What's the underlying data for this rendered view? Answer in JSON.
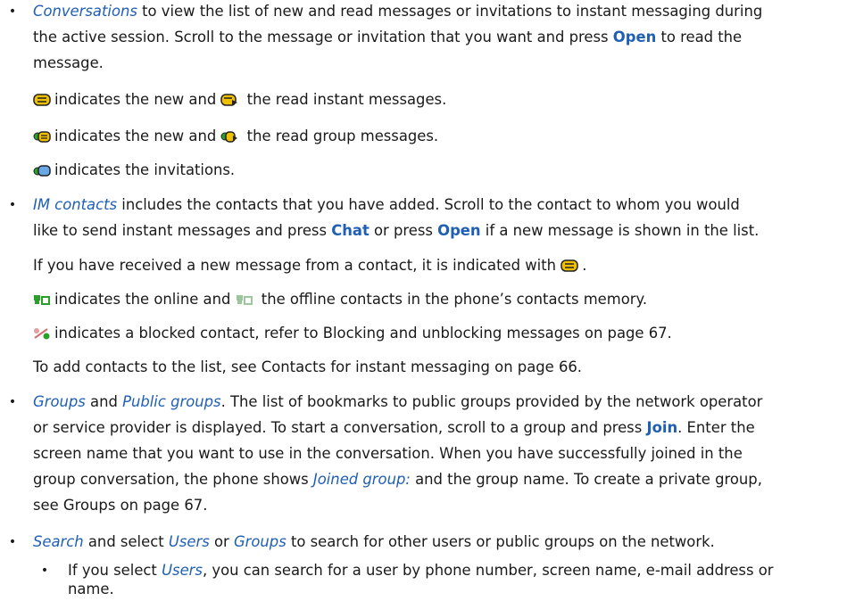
{
  "bullet_glyph": "•",
  "conversations": {
    "title": "Conversations",
    "l1": " to view the list of new and read messages or invitations to instant messaging during",
    "l2a": "the active session. Scroll to the message or invitation that you want and press ",
    "open": "Open",
    "l2b": " to read the",
    "l3": "message.",
    "im_line_a": "indicates the new and ",
    "im_line_b": " the read instant messages.",
    "grp_line_a": "indicates the new and ",
    "grp_line_b": " the read group messages.",
    "inv_line": "indicates the invitations."
  },
  "im_contacts": {
    "title": "IM contacts",
    "l1": " includes the contacts that you have added. Scroll to the contact to whom you would",
    "l2a": "like to send instant messages and press ",
    "chat": "Chat",
    "l2b": " or press ",
    "open": "Open",
    "l2c": " if a new message is shown in the list.",
    "received": "If you have received a new message from a contact, it is indicated with ",
    "received_end": ".",
    "online_a": "indicates the online and ",
    "online_b": " the offline contacts in the phone’s contacts memory.",
    "blocked": "indicates a blocked contact, refer to Blocking and unblocking messages on page 67.",
    "add": "To add contacts to the list, see Contacts for instant messaging on page 66."
  },
  "groups": {
    "title1": "Groups",
    "and": " and ",
    "title2": "Public groups",
    "l1": ". The list of bookmarks to public groups provided by the network operator",
    "l2a": "or service provider is displayed. To start a conversation, scroll to a group and press ",
    "join": "Join",
    "l2b": ". Enter the",
    "l3": "screen name that you want to use in the conversation. When you have successfully joined in the",
    "l4a": "group conversation, the phone shows ",
    "joined": "Joined group:",
    "l4b": " and the group name. To create a private group,",
    "l5": "see Groups on page 67."
  },
  "search": {
    "title": "Search",
    "l1a": " and select ",
    "users": "Users",
    "or": " or ",
    "groups": "Groups",
    "l1b": " to search for other users or public groups on the network.",
    "sub_a": "If you select ",
    "sub_users": "Users",
    "sub_b": ", you can search for a user by phone number, screen name, e-mail address or",
    "sub_c": "name."
  },
  "colors": {
    "accent": "#1f5fb4",
    "text": "#1a1a1a",
    "icon_yellow": "#f0c000",
    "icon_green": "#2aa02a"
  },
  "icons": [
    "new-im-icon",
    "read-im-icon",
    "new-group-msg-icon",
    "read-group-msg-icon",
    "invitation-icon",
    "online-contact-icon",
    "offline-contact-icon",
    "blocked-contact-icon"
  ]
}
